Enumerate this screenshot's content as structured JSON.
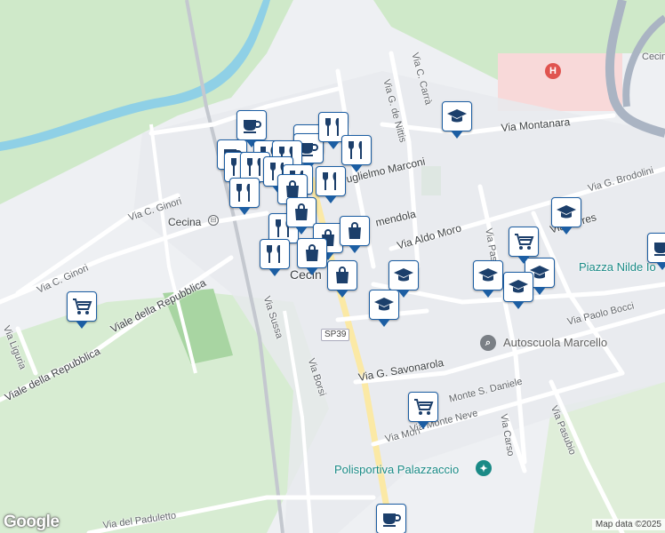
{
  "map": {
    "colors": {
      "water": "#8fd0e6",
      "park": "#cfe9c9",
      "sport": "#a8d5a2",
      "hospital_area": "#f8d9d9",
      "road": "#ffffff",
      "major_road": "#fbe9a5",
      "pin_border": "#1c5ea3",
      "icon": "#1c3f6b",
      "teal_label": "#1a8a86",
      "grey_label": "#616161"
    },
    "streets": [
      {
        "name": "Via C. Ginori"
      },
      {
        "name": "Via C. Ginori"
      },
      {
        "name": "Viale della Repubblica"
      },
      {
        "name": "Viale della Repubblica"
      },
      {
        "name": "Via Liguria"
      },
      {
        "name": "Via Sussa"
      },
      {
        "name": "Via Borsi"
      },
      {
        "name": "Via C. Carrà"
      },
      {
        "name": "Via G. de Nittis"
      },
      {
        "name": "Via Montanara"
      },
      {
        "name": "uglielmo Marconi"
      },
      {
        "name": "mendola"
      },
      {
        "name": "Via Aldo Moro"
      },
      {
        "name": "Via Torres"
      },
      {
        "name": "Via G. Brodolini"
      },
      {
        "name": "Via Pas"
      },
      {
        "name": "Via Paolo Bocci"
      },
      {
        "name": "Via G. Savonarola"
      },
      {
        "name": "Monte S. Daniele"
      },
      {
        "name": "Via Mon"
      },
      {
        "name": "Via Monte Neve"
      },
      {
        "name": "Via Carso"
      },
      {
        "name": "Via Pasubio"
      },
      {
        "name": "Via del Paduletto"
      },
      {
        "name": "Cecina"
      }
    ],
    "places": {
      "station_label": "Cecina",
      "town_label": "Cecin",
      "piazza": "Piazza Nilde Io",
      "autoscuola": "Autoscuola Marcello",
      "polisportiva": "Polisportiva Palazzaccio",
      "road_shield": "SP39",
      "hospital_letter": "H"
    },
    "pins": [
      {
        "icon": "cafe-icon"
      },
      {
        "icon": "cafe-icon"
      },
      {
        "icon": "cafe-icon"
      },
      {
        "icon": "cafe-icon"
      },
      {
        "icon": "restaurant-icon"
      },
      {
        "icon": "restaurant-icon"
      },
      {
        "icon": "restaurant-icon"
      },
      {
        "icon": "restaurant-icon"
      },
      {
        "icon": "restaurant-icon"
      },
      {
        "icon": "restaurant-icon"
      },
      {
        "icon": "restaurant-icon"
      },
      {
        "icon": "restaurant-icon"
      },
      {
        "icon": "restaurant-icon"
      },
      {
        "icon": "restaurant-icon"
      },
      {
        "icon": "restaurant-icon"
      },
      {
        "icon": "restaurant-icon"
      },
      {
        "icon": "shopping-bag-icon"
      },
      {
        "icon": "shopping-bag-icon"
      },
      {
        "icon": "shopping-bag-icon"
      },
      {
        "icon": "shopping-bag-icon"
      },
      {
        "icon": "shopping-bag-icon"
      },
      {
        "icon": "shopping-bag-icon"
      },
      {
        "icon": "school-icon"
      },
      {
        "icon": "school-icon"
      },
      {
        "icon": "school-icon"
      },
      {
        "icon": "school-icon"
      },
      {
        "icon": "school-icon"
      },
      {
        "icon": "school-icon"
      },
      {
        "icon": "school-icon"
      },
      {
        "icon": "cart-icon"
      },
      {
        "icon": "cart-icon"
      },
      {
        "icon": "cart-icon"
      },
      {
        "icon": "cafe-icon"
      },
      {
        "icon": "cafe-icon"
      }
    ],
    "branding": "Google",
    "attribution": "Map data ©2025"
  }
}
